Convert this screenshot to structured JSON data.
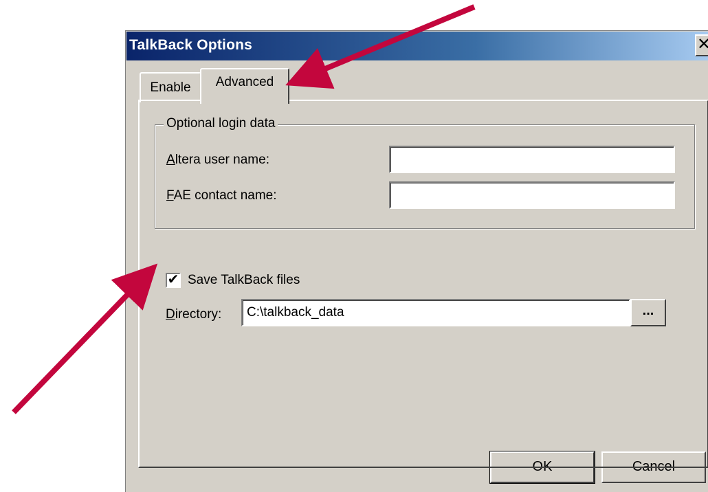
{
  "window": {
    "title": "TalkBack Options",
    "close_label": "✕"
  },
  "tabs": [
    {
      "label": "Enable",
      "active": false
    },
    {
      "label": "Advanced",
      "active": true
    }
  ],
  "login_group": {
    "legend": "Optional login data",
    "user_name": {
      "mnemonic": "A",
      "label_rest": "ltera user name:",
      "value": ""
    },
    "fae_contact": {
      "mnemonic": "F",
      "label_rest": "AE contact name:",
      "value": ""
    }
  },
  "save_files": {
    "checked": true,
    "check_mark": "✔",
    "label": "Save TalkBack files"
  },
  "directory": {
    "mnemonic": "D",
    "label_rest": "irectory:",
    "value": "C:\\talkback_data",
    "browse_label": "..."
  },
  "buttons": {
    "ok": "OK",
    "cancel": "Cancel"
  },
  "annotation_color": "#c3063d"
}
